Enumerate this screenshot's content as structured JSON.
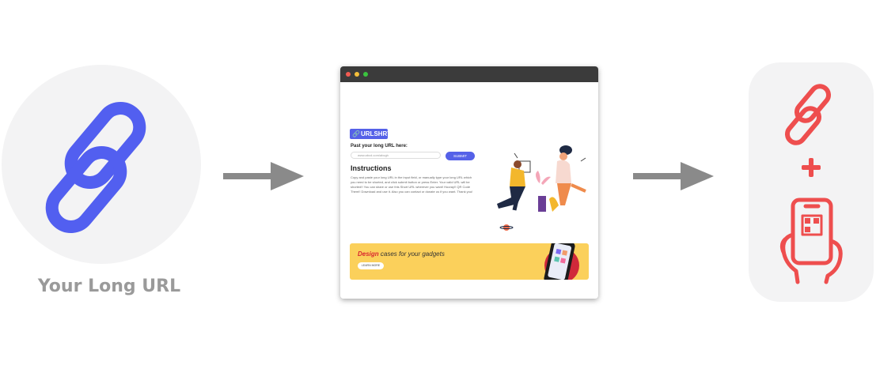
{
  "left": {
    "caption": "Your Long URL",
    "icon": "chain-link-icon",
    "icon_color": "#525ff0"
  },
  "arrows": {
    "icon": "right-arrow-icon",
    "color": "#8a8a8a"
  },
  "browser": {
    "logo_text": "URLSHRT",
    "paste_label": "Past your long URL here:",
    "input_placeholder": "www.abcd.com/abcgh",
    "submit_label": "SUBMIT",
    "instructions_title": "Instructions",
    "instructions_text": "Copy and paste your long URL in the input field, or manually type your long URL which you need to be shorted, and click submit button or press Enter. Your valid URL will be shorted!! You can share or use this Short URL wherever you want! Hooray!! QR Code Them!! Download and use it. Also you can contact or donate us if you want. Thank you!",
    "banner_strong": "Design",
    "banner_rest": " cases for your gadgets",
    "banner_button": "LEARN MORE",
    "accent_color": "#5561e8",
    "banner_color": "#fbd05b"
  },
  "right": {
    "plus": "+",
    "link_icon": "chain-link-icon",
    "phone_icon": "hand-holding-phone-qr-icon",
    "icon_color": "#ee4e4e"
  }
}
